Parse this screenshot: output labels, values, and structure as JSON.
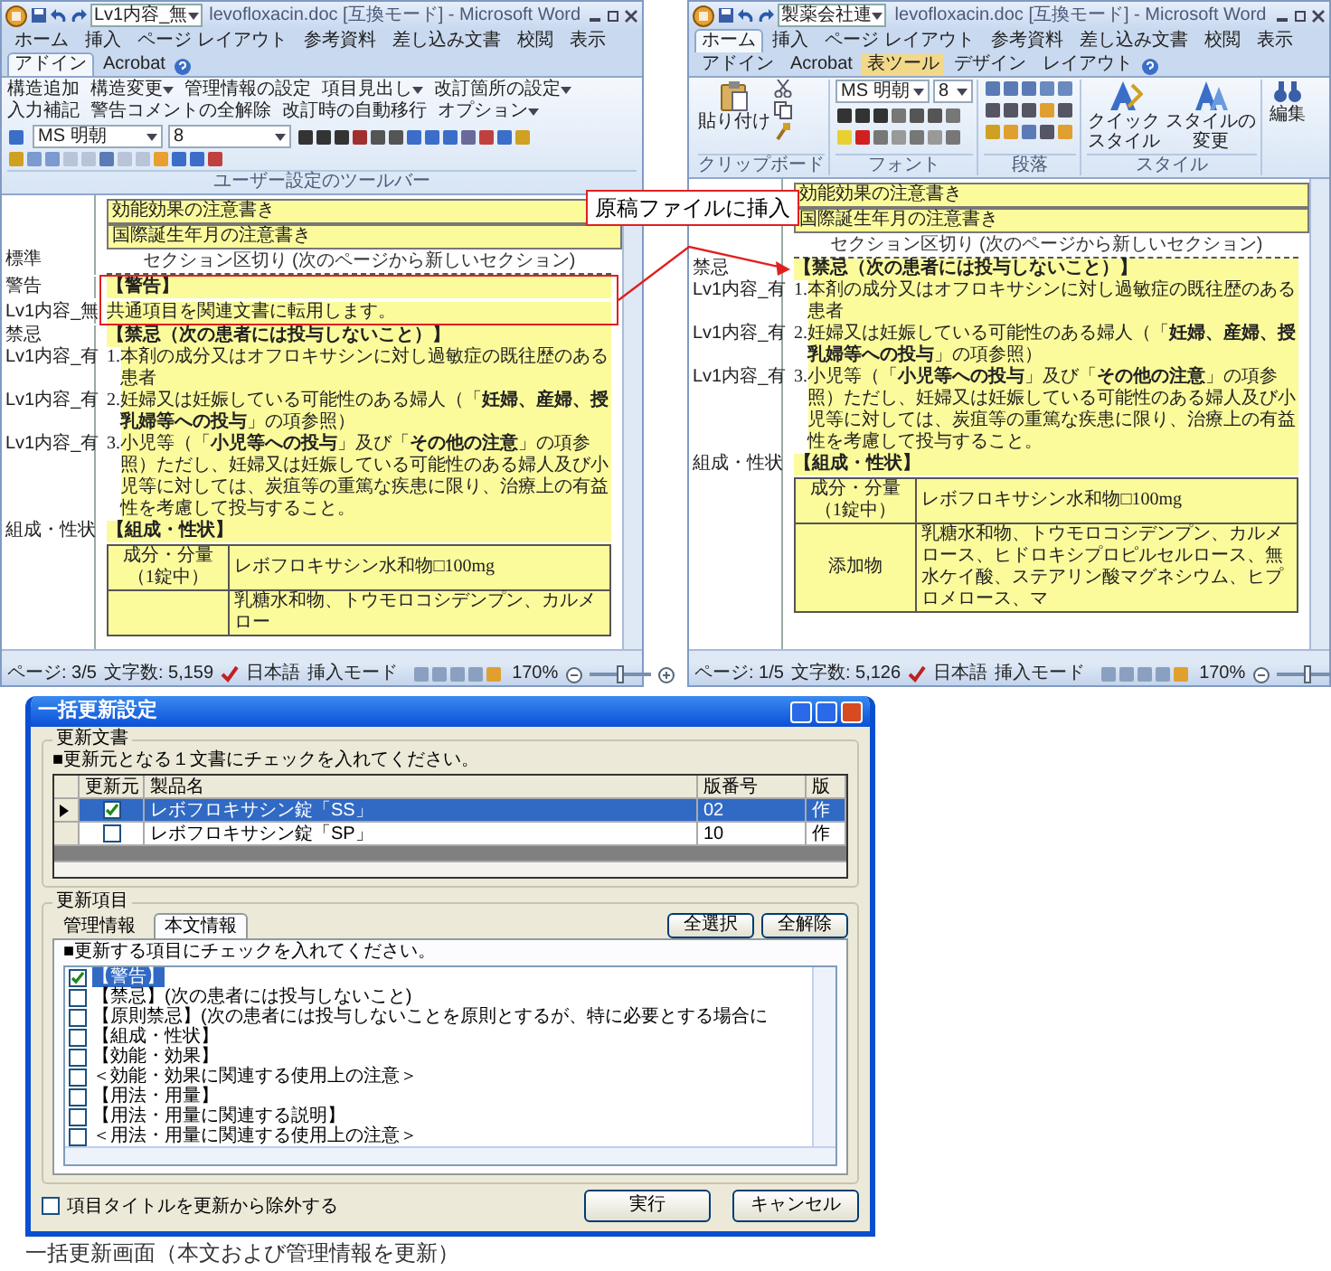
{
  "word_windows": [
    {
      "title": "levofloxacin.doc [互換モード] - Microsoft Word",
      "style_box": "Lv1内容_無",
      "tabs": [
        {
          "label": "ホーム",
          "selected": false
        },
        {
          "label": "挿入",
          "selected": false
        },
        {
          "label": "ページ レイアウト",
          "selected": false
        },
        {
          "label": "参考資料",
          "selected": false
        },
        {
          "label": "差し込み文書",
          "selected": false
        },
        {
          "label": "校閲",
          "selected": false
        },
        {
          "label": "表示",
          "selected": false
        },
        {
          "label": "アドイン",
          "selected": true
        },
        {
          "label": "Acrobat",
          "selected": false
        }
      ],
      "ribbon": {
        "kind": "addin",
        "menu": [
          {
            "label": "構造追加",
            "dropdown": false
          },
          {
            "label": "構造変更",
            "dropdown": true
          },
          {
            "label": "管理情報の設定",
            "dropdown": false
          },
          {
            "label": "項目見出し",
            "dropdown": true
          },
          {
            "label": "改訂箇所の設定",
            "dropdown": true
          },
          {
            "label": "入力補記",
            "dropdown": false
          },
          {
            "label": "警告コメントの全解除",
            "dropdown": false
          },
          {
            "label": "改訂時の自動移行",
            "dropdown": false
          },
          {
            "label": "オプション",
            "dropdown": true
          }
        ],
        "font": "MS 明朝",
        "size": "8",
        "group_label": "ユーザー設定のツールバー"
      },
      "document": {
        "header_boxes": [
          "効能効果の注意書き",
          "国際誕生年月の注意書き"
        ],
        "section_break": {
          "text": "セクション区切り (次のページから新しいセクション)",
          "style": "標準"
        },
        "paragraphs": [
          {
            "style": "警告",
            "kind": "heading",
            "text": "【警告】",
            "framed": true
          },
          {
            "style": "Lv1内容_無",
            "kind": "text",
            "text": "共通項目を関連文書に転用します。",
            "framed": true
          },
          {
            "style": "禁忌",
            "kind": "heading",
            "text": "【禁忌（次の患者には投与しないこと）】",
            "framed": false
          },
          {
            "style": "Lv1内容_有",
            "kind": "item",
            "number": "1.",
            "text": "本剤の成分又はオフロキサシンに対し過敏症の既往歴のある患者",
            "framed": false
          },
          {
            "style": "Lv1内容_有",
            "kind": "item",
            "number": "2.",
            "text": "妊婦又は妊娠している可能性のある婦人（「**妊婦、産婦、授乳婦等への投与**」の項参照）",
            "framed": false
          },
          {
            "style": "Lv1内容_有",
            "kind": "item",
            "number": "3.",
            "text": "小児等（「**小児等への投与**」及び「**その他の注意**」の項参照）ただし、妊婦又は妊娠している可能性のある婦人及び小児等に対しては、炭疽等の重篤な疾患に限り、治療上の有益性を考慮して投与すること。",
            "framed": false
          },
          {
            "style": "組成・性状",
            "kind": "heading",
            "text": "【組成・性状】",
            "framed": false
          }
        ],
        "table": [
          {
            "label": "成分・分量（1錠中）",
            "value": "レボフロキサシン水和物□100mg"
          },
          {
            "value": "乳糖水和物、トウモロコシデンプン、カルメロー"
          }
        ]
      },
      "status": {
        "page": "ページ: 3/5",
        "words": "文字数: 5,159",
        "language": "日本語",
        "mode": "挿入モード",
        "zoom": "170%",
        "zoom_slider": {
          "level": 0.5
        }
      }
    },
    {
      "title": "levofloxacin.doc [互換モード] - Microsoft Word",
      "style_box": "製薬会社連",
      "context_label": "表ツール",
      "tabs": [
        {
          "label": "ホーム",
          "selected": true
        },
        {
          "label": "挿入",
          "selected": false
        },
        {
          "label": "ページ レイアウト",
          "selected": false
        },
        {
          "label": "参考資料",
          "selected": false
        },
        {
          "label": "差し込み文書",
          "selected": false
        },
        {
          "label": "校閲",
          "selected": false
        },
        {
          "label": "表示",
          "selected": false
        },
        {
          "label": "アドイン",
          "selected": false
        },
        {
          "label": "Acrobat",
          "selected": false
        },
        {
          "label": "デザイン",
          "selected": false
        },
        {
          "label": "レイアウト",
          "selected": false
        }
      ],
      "ribbon": {
        "kind": "home",
        "paste": "貼り付け",
        "font": "MS 明朝",
        "size": "8",
        "quick_style": "クイックスタイル",
        "change_style": "スタイルの変更",
        "edit": "編集",
        "group_labels": [
          "クリップボード",
          "フォント",
          "段落",
          "スタイル"
        ]
      },
      "document": {
        "header_boxes": [
          "効能効果の注意書き",
          "国際誕生年月の注意書き"
        ],
        "section_break": {
          "text": "セクション区切り (次のページから新しいセクション)"
        },
        "paragraphs": [
          {
            "style": "禁忌",
            "kind": "heading",
            "text": "【禁忌（次の患者には投与しないこと）】",
            "framed": false
          },
          {
            "style": "Lv1内容_有",
            "kind": "item",
            "number": "1.",
            "text": "本剤の成分又はオフロキサシンに対し過敏症の既往歴のある患者",
            "framed": false
          },
          {
            "style": "Lv1内容_有",
            "kind": "item",
            "number": "2.",
            "text": "妊婦又は妊娠している可能性のある婦人（「**妊婦、産婦、授乳婦等への投与**」の項参照）",
            "framed": false
          },
          {
            "style": "Lv1内容_有",
            "kind": "item",
            "number": "3.",
            "text": "小児等（「**小児等への投与**」及び「**その他の注意**」の項参照）ただし、妊婦又は妊娠している可能性のある婦人及び小児等に対しては、炭疽等の重篤な疾患に限り、治療上の有益性を考慮して投与すること。",
            "framed": false
          },
          {
            "style": "組成・性状",
            "kind": "heading",
            "text": "【組成・性状】",
            "framed": false
          }
        ],
        "table": [
          {
            "label": "成分・分量（1錠中）",
            "value": "レボフロキサシン水和物□100mg"
          },
          {
            "label": "添加物",
            "value": "乳糖水和物、トウモロコシデンプン、カルメロース、ヒドロキシプロピルセルロース、無水ケイ酸、ステアリン酸マグネシウム、ヒプロメロース、マ"
          }
        ]
      },
      "status": {
        "page": "ページ: 1/5",
        "words": "文字数: 5,126",
        "language": "日本語",
        "mode": "挿入モード",
        "zoom": "170%",
        "zoom_slider": {
          "level": 0.5
        }
      }
    }
  ],
  "callout": "原稿ファイルに挿入",
  "dialog": {
    "title": "一括更新設定",
    "documents_group": {
      "legend": "更新文書",
      "instruction": "■更新元となる１文書にチェックを入れてください。",
      "check_column": "更新元",
      "columns": [
        "製品名",
        "版番号",
        "版"
      ],
      "rows": [
        {
          "selected": true,
          "checked": true,
          "cells": [
            "レボフロキサシン錠「SS」",
            "02",
            "作"
          ]
        },
        {
          "selected": false,
          "checked": false,
          "cells": [
            "レボフロキサシン錠「SP」",
            "10",
            "作"
          ]
        }
      ]
    },
    "items_group": {
      "legend": "更新項目",
      "tabs": [
        {
          "label": "管理情報",
          "selected": false
        },
        {
          "label": "本文情報",
          "selected": true
        }
      ],
      "select_all": "全選択",
      "clear_all": "全解除",
      "instruction": "■更新する項目にチェックを入れてください。",
      "items": [
        {
          "text": "【警告】",
          "checked": true,
          "selected": true
        },
        {
          "text": "【禁忌】(次の患者には投与しないこと)",
          "checked": false,
          "selected": false
        },
        {
          "text": "【原則禁忌】(次の患者には投与しないことを原則とするが、特に必要とする場合に",
          "checked": false,
          "selected": false
        },
        {
          "text": "【組成・性状】",
          "checked": false,
          "selected": false
        },
        {
          "text": "【効能・効果】",
          "checked": false,
          "selected": false
        },
        {
          "text": "＜効能・効果に関連する使用上の注意＞",
          "checked": false,
          "selected": false
        },
        {
          "text": "【用法・用量】",
          "checked": false,
          "selected": false
        },
        {
          "text": "【用法・用量に関連する説明】",
          "checked": false,
          "selected": false
        },
        {
          "text": "＜用法・用量に関連する使用上の注意＞",
          "checked": false,
          "selected": false
        }
      ]
    },
    "exclude_option": {
      "label": "項目タイトルを更新から除外する",
      "checked": false
    },
    "buttons": [
      "実行",
      "キャンセル"
    ]
  },
  "caption": "一括更新画面（本文および管理情報を更新）"
}
